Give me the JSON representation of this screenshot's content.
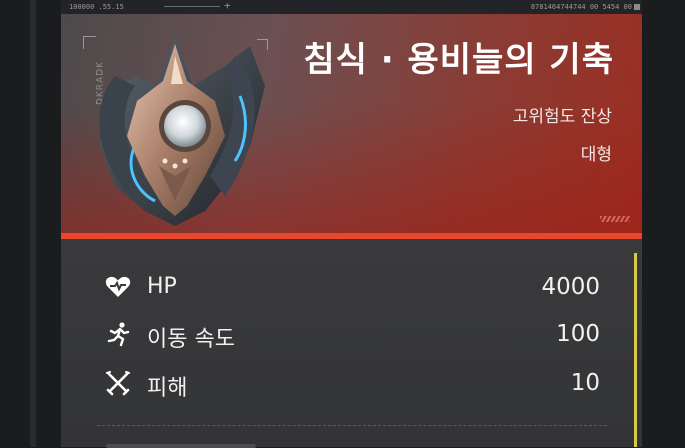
{
  "top_strip": {
    "left_text": "100000  .55.15",
    "right_text": "8781464744744 00 5454 00"
  },
  "boss": {
    "name": "침식 · 용비늘의 기축",
    "threat": "고위험도 잔상",
    "size": "대형",
    "side_glyphs": "ꓘꓷꓯꓤꓘꓷ"
  },
  "stats": [
    {
      "icon": "heart-icon",
      "label": "HP",
      "value": "4000"
    },
    {
      "icon": "running-icon",
      "label": "이동 속도",
      "value": "100"
    },
    {
      "icon": "crossed-swords-icon",
      "label": "피해",
      "value": "10"
    }
  ],
  "colors": {
    "accent": "#e8472c",
    "highlight_bar": "#d9c84e"
  }
}
